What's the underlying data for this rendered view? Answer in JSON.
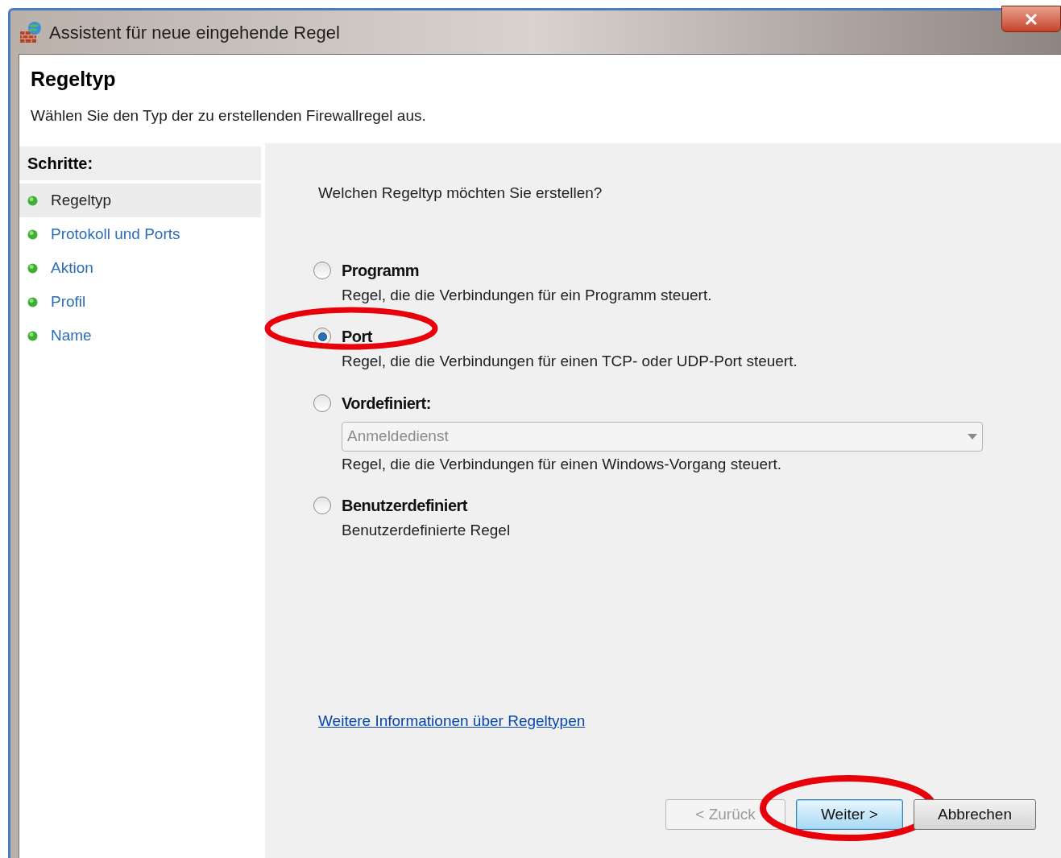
{
  "window": {
    "title": "Assistent für neue eingehende Regel"
  },
  "header": {
    "title": "Regeltyp",
    "subtitle": "Wählen Sie den Typ der zu erstellenden Firewallregel aus."
  },
  "steps": {
    "heading": "Schritte:",
    "items": [
      {
        "label": "Regeltyp",
        "selected": true
      },
      {
        "label": "Protokoll und Ports",
        "selected": false
      },
      {
        "label": "Aktion",
        "selected": false
      },
      {
        "label": "Profil",
        "selected": false
      },
      {
        "label": "Name",
        "selected": false
      }
    ]
  },
  "question": "Welchen Regeltyp möchten Sie erstellen?",
  "options": [
    {
      "kind": "plain",
      "label": "Programm",
      "description": "Regel, die die Verbindungen für ein Programm steuert.",
      "selected": false,
      "highlighted": false
    },
    {
      "kind": "plain",
      "label": "Port",
      "description": "Regel, die die Verbindungen für einen TCP- oder UDP-Port steuert.",
      "selected": true,
      "highlighted": true
    },
    {
      "kind": "dropdown",
      "label": "Vordefiniert:",
      "dropdown": {
        "value": "Anmeldedienst",
        "disabled": true
      },
      "description": "Regel, die die Verbindungen für einen Windows-Vorgang steuert.",
      "selected": false,
      "highlighted": false
    },
    {
      "kind": "plain",
      "label": "Benutzerdefiniert",
      "description": "Benutzerdefinierte Regel",
      "selected": false,
      "highlighted": false
    }
  ],
  "link": "Weitere Informationen über Regeltypen",
  "buttons": [
    {
      "label": "< Zurück",
      "disabled": true,
      "default": false,
      "highlighted": false
    },
    {
      "label": "Weiter >",
      "disabled": false,
      "default": true,
      "highlighted": true
    },
    {
      "label": "Abbrechen",
      "disabled": false,
      "default": false,
      "highlighted": false
    }
  ]
}
